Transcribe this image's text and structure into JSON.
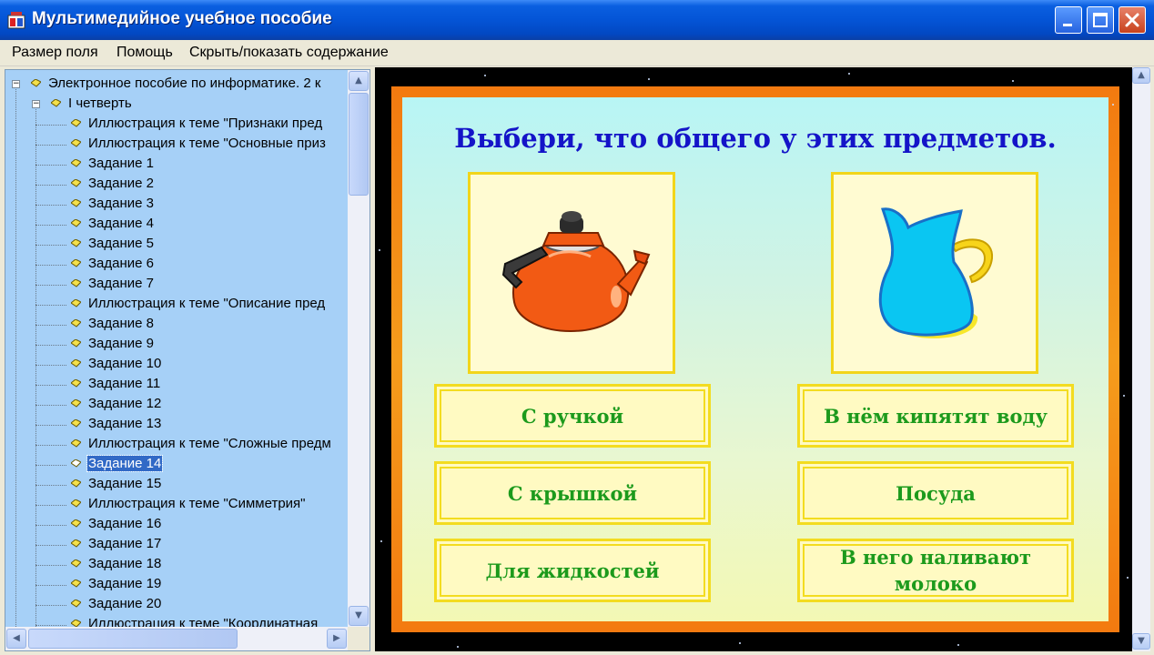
{
  "window": {
    "title": "Мультимедийное учебное пособие",
    "minimize_label": "minimize",
    "maximize_label": "maximize",
    "close_label": "close"
  },
  "menu": {
    "items": [
      "Размер поля",
      "Помощь",
      "Скрыть/показать содержание"
    ]
  },
  "tree": {
    "root": "Электронное пособие по информатике. 2 к",
    "quarter": "I четверть",
    "items": [
      "Иллюстрация к теме \"Признаки пред",
      "Иллюстрация к теме \"Основные приз",
      "Задание 1",
      "Задание 2",
      "Задание 3",
      "Задание 4",
      "Задание 5",
      "Задание 6",
      "Задание 7",
      "Иллюстрация к теме \"Описание пред",
      "Задание 8",
      "Задание 9",
      "Задание 10",
      "Задание 11",
      "Задание 12",
      "Задание 13",
      "Иллюстрация к теме \"Сложные предм",
      "Задание 14",
      "Задание 15",
      "Иллюстрация к теме \"Симметрия\"",
      "Задание 16",
      "Задание 17",
      "Задание 18",
      "Задание 19",
      "Задание 20",
      "Иллюстрация к теме \"Координатная"
    ],
    "selected_index": 17
  },
  "task": {
    "question": "Выбери, что общего у этих предметов.",
    "picture_left": "kettle-icon",
    "picture_right": "jug-icon",
    "answers": [
      "С ручкой",
      "В нём кипятят воду",
      "С крышкой",
      "Посуда",
      "Для жидкостей",
      "В него наливают молоко"
    ]
  },
  "colors": {
    "title_bar": "#0454d6",
    "tree_background": "#a6d0f7",
    "question_text": "#1414c8",
    "answer_text": "#1c9a1c",
    "frame": "#f37a10"
  }
}
